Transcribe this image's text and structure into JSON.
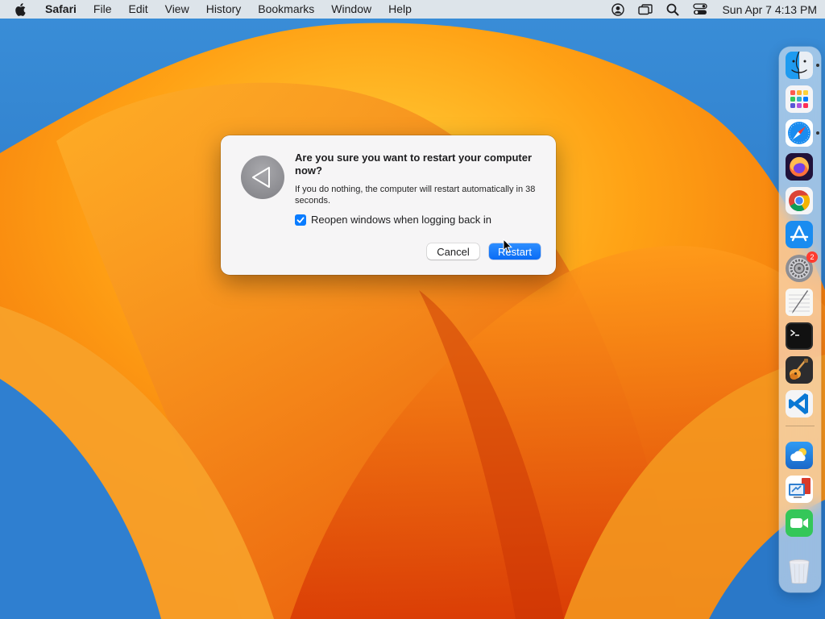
{
  "menubar": {
    "app_name": "Safari",
    "menus": [
      "File",
      "Edit",
      "View",
      "History",
      "Bookmarks",
      "Window",
      "Help"
    ],
    "clock": "Sun Apr 7  4:13 PM"
  },
  "dialog": {
    "title": "Are you sure you want to restart your computer now?",
    "message": "If you do nothing, the computer will restart automatically in 38 seconds.",
    "checkbox_label": "Reopen windows when logging back in",
    "checkbox_checked": true,
    "cancel_label": "Cancel",
    "restart_label": "Restart"
  },
  "dock": {
    "items": [
      "finder",
      "launchpad",
      "safari",
      "firefox",
      "chrome",
      "app-store",
      "system-settings",
      "script-editor",
      "terminal",
      "garageband",
      "vscode",
      "weather",
      "remote-desktop",
      "facetime",
      "trash"
    ],
    "settings_badge": "2"
  },
  "colors": {
    "accent": "#0a7cff",
    "wallpaper_orange": "#f58a0a",
    "wallpaper_blue": "#2c7fd0"
  }
}
